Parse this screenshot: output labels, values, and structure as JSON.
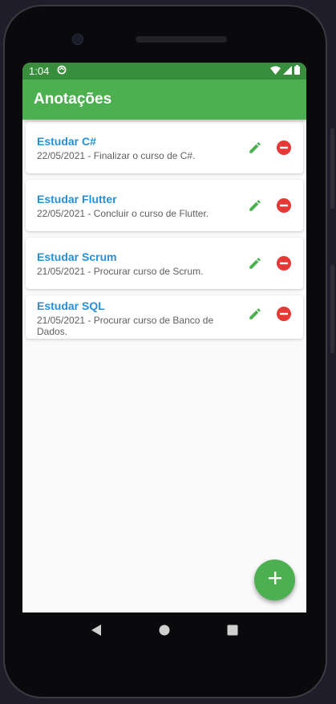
{
  "status_bar": {
    "time": "1:04"
  },
  "app_bar": {
    "title": "Anotações"
  },
  "notes": [
    {
      "title": "Estudar C#",
      "subtitle": "22/05/2021 - Finalizar o curso de C#."
    },
    {
      "title": "Estudar Flutter",
      "subtitle": "22/05/2021 - Concluir o curso de Flutter."
    },
    {
      "title": "Estudar Scrum",
      "subtitle": "21/05/2021 - Procurar curso de Scrum."
    },
    {
      "title": "Estudar SQL",
      "subtitle": "21/05/2021 - Procurar curso de Banco de Dados."
    }
  ],
  "icons": {
    "edit": "pencil-icon",
    "delete": "remove-circle-icon",
    "fab": "plus-icon",
    "nav_back": "triangle-back-icon",
    "nav_home": "circle-home-icon",
    "nav_recents": "square-recents-icon"
  },
  "colors": {
    "status_bar": "#388e3c",
    "app_bar": "#4caf50",
    "title_blue": "#2a8fd4",
    "edit_green": "#4caf50",
    "delete_red": "#e53935"
  }
}
